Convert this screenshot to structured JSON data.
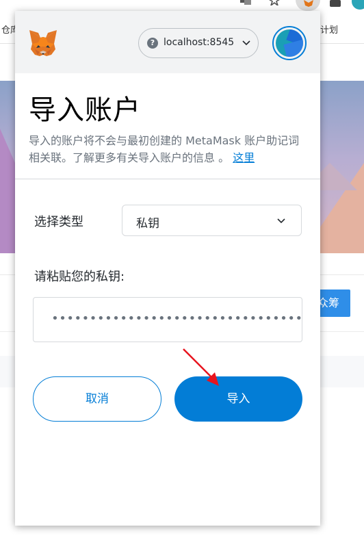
{
  "browser": {
    "bookmark_left": "仓库",
    "bookmark_right": "计划",
    "background_button": "众筹"
  },
  "popup": {
    "network": "localhost:8545",
    "title": "导入账户",
    "description": "导入的账户将不会与最初创建的 MetaMask 账户助记词相关联。了解更多有关导入账户的信息 。",
    "here_link": "这里",
    "select_type_label": "选择类型",
    "select_type_value": "私钥",
    "paste_key_label": "请粘贴您的私钥:",
    "private_key_masked": "••••••••••••••••••••••••••••••••••••••••••••••••",
    "cancel_label": "取消",
    "import_label": "导入"
  },
  "colors": {
    "accent": "#037dd6",
    "header_bg": "#f2f3f4",
    "annotation_arrow": "#e8141e"
  },
  "icons": [
    "metamask-fox-icon",
    "network-help-icon",
    "chevron-down-icon",
    "account-avatar-icon",
    "annotation-arrow-icon"
  ]
}
